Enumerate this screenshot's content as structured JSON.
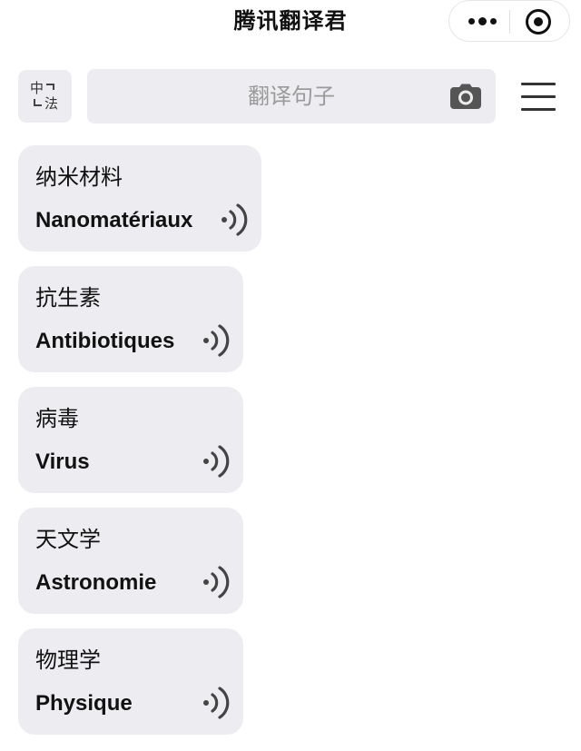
{
  "app": {
    "title": "腾讯翻译君"
  },
  "lang": {
    "source": "中",
    "target": "法"
  },
  "search": {
    "placeholder": "翻译句子",
    "value": ""
  },
  "icons": {
    "more": "more-icon",
    "close": "target-close-icon",
    "swap": "swap-arrows-icon",
    "camera": "camera-icon",
    "menu": "hamburger-menu-icon",
    "speaker": "speaker-icon"
  },
  "colors": {
    "card_bg": "#ededf1",
    "text": "#111111",
    "placeholder": "#9a9a9a",
    "icon": "#333333"
  },
  "cards": [
    {
      "source": "纳米材料",
      "target": "Nanomatériaux"
    },
    {
      "source": "抗生素",
      "target": "Antibiotiques"
    },
    {
      "source": "病毒",
      "target": "Virus"
    },
    {
      "source": "天文学",
      "target": "Astronomie"
    },
    {
      "source": "物理学",
      "target": "Physique"
    }
  ]
}
